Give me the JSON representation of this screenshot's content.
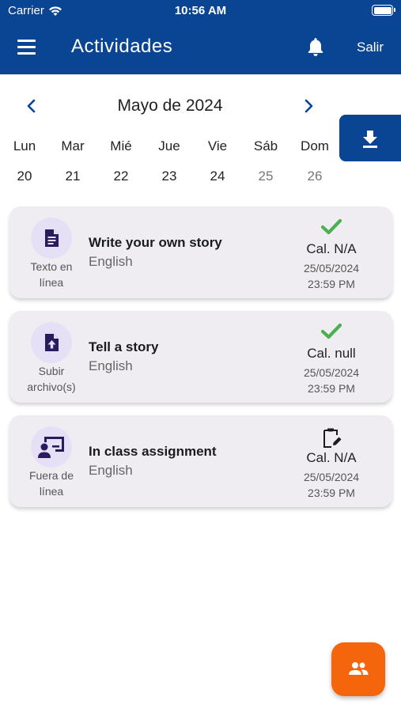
{
  "status_bar": {
    "carrier": "Carrier",
    "time": "10:56 AM"
  },
  "appbar": {
    "title": "Actividades",
    "logout_label": "Salir",
    "icons": [
      "menu-icon",
      "bell-icon"
    ]
  },
  "calendar": {
    "month_label": "Mayo de 2024",
    "days": [
      {
        "name": "Lun",
        "num": "20"
      },
      {
        "name": "Mar",
        "num": "21"
      },
      {
        "name": "Mié",
        "num": "22"
      },
      {
        "name": "Jue",
        "num": "23"
      },
      {
        "name": "Vie",
        "num": "24"
      },
      {
        "name": "Sáb",
        "num": "25"
      },
      {
        "name": "Dom",
        "num": "26"
      }
    ]
  },
  "activities": [
    {
      "type_label": "Texto en línea",
      "icon": "document-icon",
      "title": "Write your own story",
      "subject": "English",
      "status_icon": "check-icon",
      "grade": "Cal. N/A",
      "date": "25/05/2024",
      "time": "23:59 PM"
    },
    {
      "type_label": "Subir archivo(s)",
      "icon": "file-upload-icon",
      "title": "Tell a story",
      "subject": "English",
      "status_icon": "check-icon",
      "grade": "Cal. null",
      "date": "25/05/2024",
      "time": "23:59 PM"
    },
    {
      "type_label": "Fuera de línea",
      "icon": "presentation-icon",
      "title": "In class assignment",
      "subject": "English",
      "status_icon": "clipboard-edit-icon",
      "grade": "Cal. N/A",
      "date": "25/05/2024",
      "time": "23:59 PM"
    }
  ],
  "colors": {
    "primary": "#0a4594",
    "fab": "#f5650c",
    "check": "#4caf50",
    "card_bg": "#efedf2",
    "icon_bg": "#e6e0f6",
    "icon_fg": "#2a1a5e"
  }
}
